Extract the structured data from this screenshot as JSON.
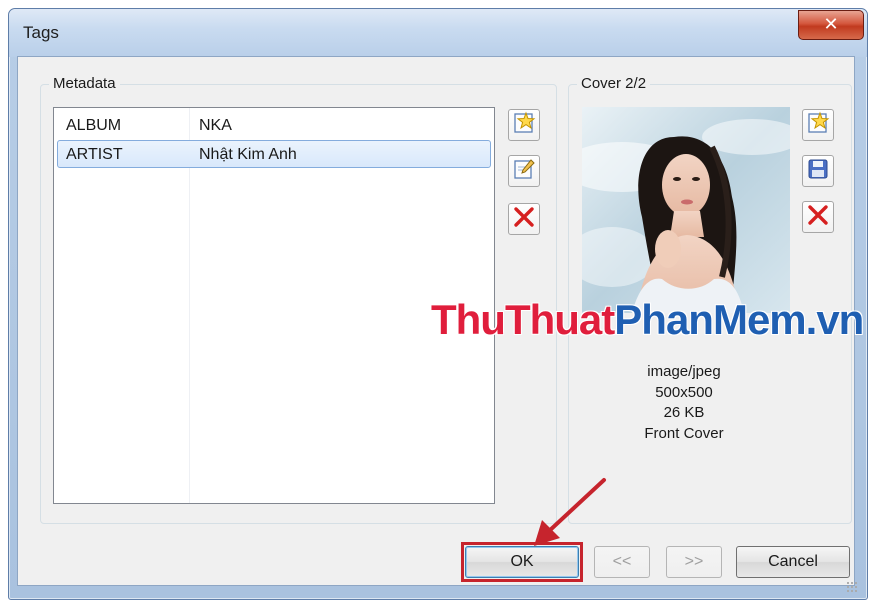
{
  "window": {
    "title": "Tags"
  },
  "metadata": {
    "legend": "Metadata",
    "rows": [
      {
        "key": "ALBUM",
        "value": "NKA",
        "selected": false
      },
      {
        "key": "ARTIST",
        "value": "Nhật Kim Anh",
        "selected": true
      }
    ],
    "buttons": [
      "add-icon",
      "edit-icon",
      "delete-icon"
    ]
  },
  "cover": {
    "legend": "Cover 2/2",
    "mime": "image/jpeg",
    "dimensions": "500x500",
    "size": "26 KB",
    "type": "Front Cover",
    "buttons": [
      "add-icon",
      "save-icon",
      "delete-icon"
    ]
  },
  "watermark": {
    "part1": "ThuThuat",
    "part2": "PhanMem.vn"
  },
  "footer": {
    "ok": "OK",
    "prev": "<<",
    "next": ">>",
    "cancel": "Cancel"
  },
  "colors": {
    "highlight_red": "#c6242d",
    "selection_border": "#84acdd",
    "watermark_red": "#e01e3c",
    "watermark_blue": "#1f5fb2"
  }
}
